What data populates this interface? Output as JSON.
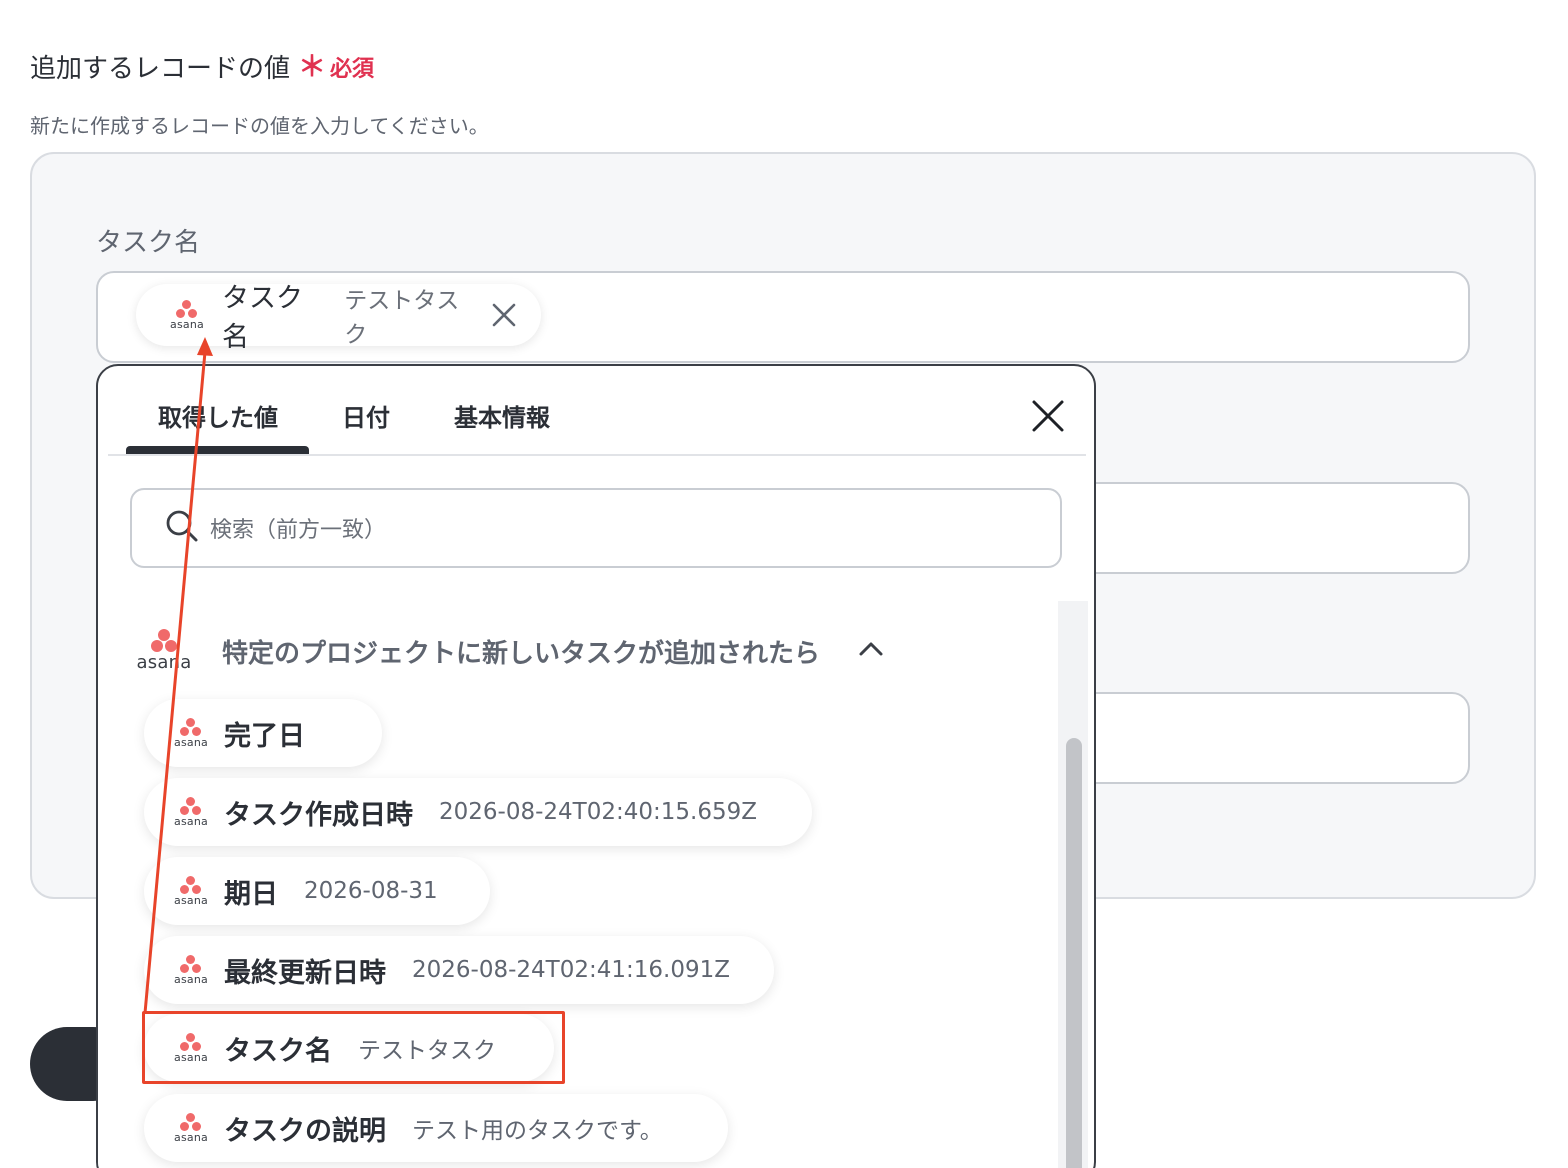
{
  "section": {
    "title": "追加するレコードの値",
    "required_mark": "＊",
    "required_label": "必須",
    "description": "新たに作成するレコードの値を入力してください。"
  },
  "field": {
    "label": "タスク名",
    "selected_chip": {
      "icon": "asana-logo-icon",
      "name": "タスク名",
      "value": "テストタスク"
    }
  },
  "popup": {
    "tabs": [
      "取得した値",
      "日付",
      "基本情報"
    ],
    "active_tab": "取得した値",
    "search_placeholder": "検索（前方一致）",
    "group_title": "特定のプロジェクトに新しいタスクが追加されたら",
    "items": [
      {
        "name": "完了日",
        "value": ""
      },
      {
        "name": "タスク作成日時",
        "value": "2026-08-24T02:40:15.659Z"
      },
      {
        "name": "期日",
        "value": "2026-08-31"
      },
      {
        "name": "最終更新日時",
        "value": "2026-08-24T02:41:16.091Z"
      },
      {
        "name": "タスク名",
        "value": "テストタスク"
      },
      {
        "name": "タスクの説明",
        "value": "テスト用のタスクです。"
      }
    ]
  },
  "brand": {
    "word": "asana"
  },
  "colors": {
    "required": "#e03150",
    "asana": "#f06a6a",
    "highlight": "#e8442a",
    "text": "#2b2f36"
  }
}
